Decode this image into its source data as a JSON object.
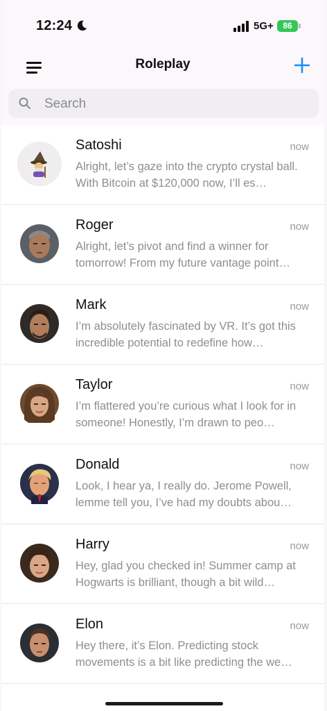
{
  "status_bar": {
    "time": "12:24",
    "network": "5G+",
    "battery": "86"
  },
  "header": {
    "title": "Roleplay"
  },
  "search": {
    "placeholder": "Search"
  },
  "colors": {
    "accent": "#1d8cf8",
    "battery_green": "#34c759",
    "secondary_text": "#8e8e93"
  },
  "chats": [
    {
      "name": "Satoshi",
      "time": "now",
      "preview": "Alright, let’s gaze into the crypto crystal ball. With Bitcoin at $120,000 now, I’ll es…",
      "avatar": "wizard-emoji"
    },
    {
      "name": "Roger",
      "time": "now",
      "preview": "Alright, let’s pivot and find a winner for tomorrow! From my future vantage point…",
      "avatar": "photo"
    },
    {
      "name": "Mark",
      "time": "now",
      "preview": "I’m absolutely fascinated by VR. It’s got this incredible potential to redefine how…",
      "avatar": "photo"
    },
    {
      "name": "Taylor",
      "time": "now",
      "preview": "I’m flattered you’re curious what I look for in someone! Honestly, I’m drawn to peo…",
      "avatar": "photo"
    },
    {
      "name": "Donald",
      "time": "now",
      "preview": "Look, I hear ya, I really do. Jerome Powell, lemme tell you, I’ve had my doubts abou…",
      "avatar": "photo"
    },
    {
      "name": "Harry",
      "time": "now",
      "preview": "Hey, glad you checked in! Summer camp at Hogwarts is brilliant, though a bit wild…",
      "avatar": "photo"
    },
    {
      "name": "Elon",
      "time": "now",
      "preview": "Hey there, it’s Elon. Predicting stock movements is a bit like predicting the we…",
      "avatar": "photo"
    }
  ]
}
